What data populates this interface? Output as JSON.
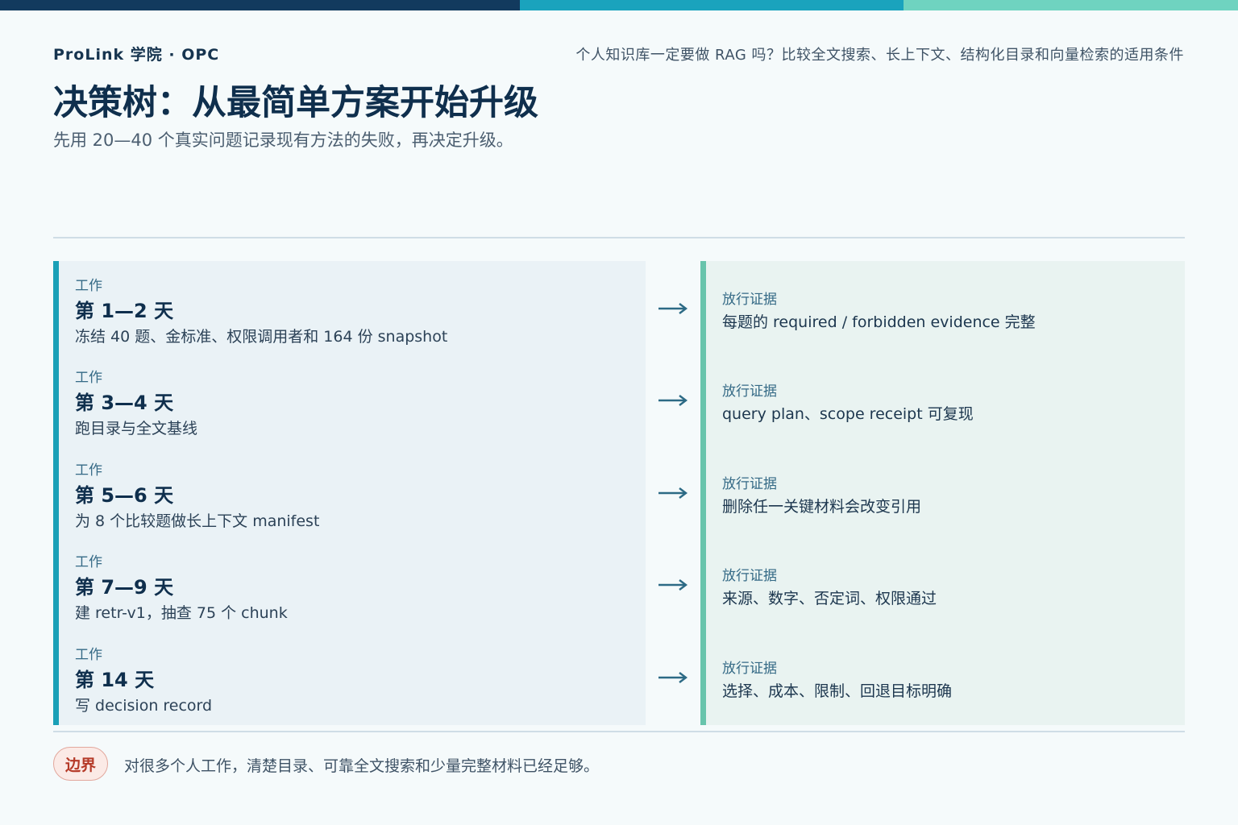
{
  "colors": {
    "bar": [
      "#123a5e",
      "#1aa3bd",
      "#6fd3c0"
    ],
    "work_accent": "#1aa0b7",
    "evidence_accent": "#68c4ac",
    "boundary_badge": "#b53a28"
  },
  "header": {
    "brand": "ProLink 学院 · OPC",
    "topic": "个人知识库一定要做 RAG 吗？比较全文搜索、长上下文、结构化目录和向量检索的适用条件",
    "title": "决策树：从最简单方案开始升级",
    "subtitle": "先用 20—40 个真实问题记录现有方法的失败，再决定升级。"
  },
  "rows": [
    {
      "work_label": "工作",
      "title": "第 1—2 天",
      "desc": "冻结 40 题、金标准、权限调用者和 164 份 snapshot",
      "evidence_label": "放行证据",
      "evidence": "每题的 required / forbidden evidence 完整",
      "arrow": "→"
    },
    {
      "work_label": "工作",
      "title": "第 3—4 天",
      "desc": "跑目录与全文基线",
      "evidence_label": "放行证据",
      "evidence": "query plan、scope receipt 可复现",
      "arrow": "→"
    },
    {
      "work_label": "工作",
      "title": "第 5—6 天",
      "desc": "为 8 个比较题做长上下文 manifest",
      "evidence_label": "放行证据",
      "evidence": "删除任一关键材料会改变引用",
      "arrow": "→"
    },
    {
      "work_label": "工作",
      "title": "第 7—9 天",
      "desc": "建 retr-v1，抽查 75 个 chunk",
      "evidence_label": "放行证据",
      "evidence": "来源、数字、否定词、权限通过",
      "arrow": "→"
    },
    {
      "work_label": "工作",
      "title": "第 14 天",
      "desc": "写 decision record",
      "evidence_label": "放行证据",
      "evidence": "选择、成本、限制、回退目标明确",
      "arrow": "→"
    }
  ],
  "footer": {
    "badge": "边界",
    "note": "对很多个人工作，清楚目录、可靠全文搜索和少量完整材料已经足够。"
  }
}
